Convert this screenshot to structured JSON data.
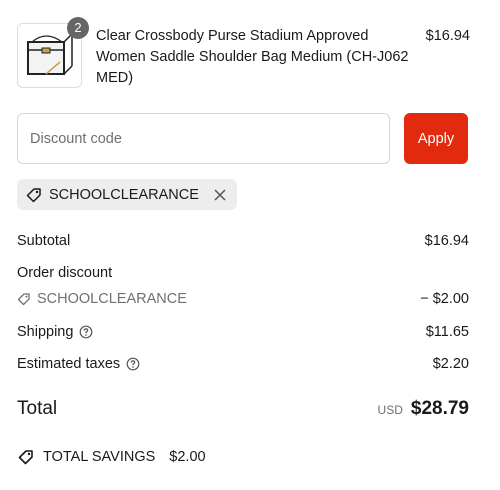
{
  "product": {
    "quantity": "2",
    "title": "Clear Crossbody Purse Stadium Approved Women Saddle Shoulder Bag Medium (CH-J062 MED)",
    "price": "$16.94"
  },
  "discount": {
    "placeholder": "Discount code",
    "apply_label": "Apply",
    "applied_code": "SCHOOLCLEARANCE"
  },
  "summary": {
    "subtotal_label": "Subtotal",
    "subtotal_value": "$16.94",
    "order_discount_label": "Order discount",
    "discount_code": "SCHOOLCLEARANCE",
    "discount_value": "− $2.00",
    "shipping_label": "Shipping",
    "shipping_value": "$11.65",
    "taxes_label": "Estimated taxes",
    "taxes_value": "$2.20"
  },
  "total": {
    "label": "Total",
    "currency": "USD",
    "amount": "$28.79"
  },
  "savings": {
    "label": "TOTAL SAVINGS",
    "amount": "$2.00"
  },
  "colors": {
    "accent": "#e22a0e",
    "chip_bg": "#ededed",
    "muted": "#707070"
  }
}
